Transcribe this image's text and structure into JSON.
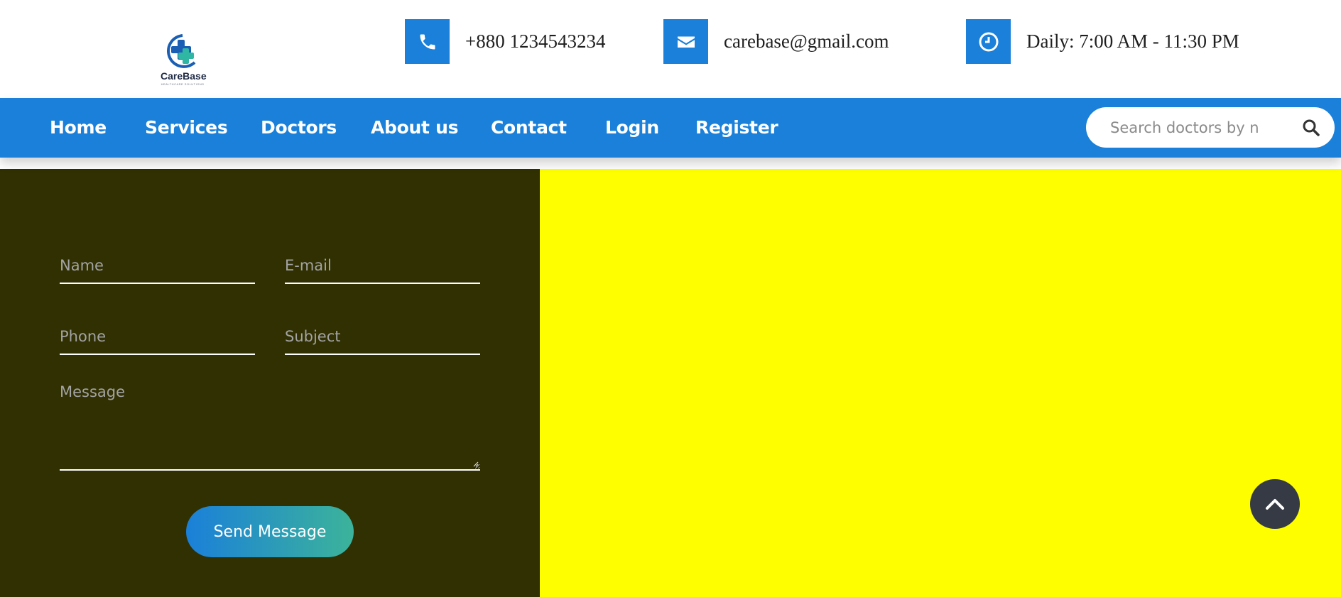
{
  "brand": {
    "logo_alt": "CareBase logo",
    "name": "CareBase",
    "tagline": "HEALTHCARE SOLUTIONS"
  },
  "topbar": {
    "phone": {
      "icon": "phone-icon",
      "text": "+880 1234543234"
    },
    "email": {
      "icon": "envelope-icon",
      "text": "carebase@gmail.com"
    },
    "hours": {
      "icon": "clock-icon",
      "text": "Daily: 7:00 AM - 11:30 PM"
    }
  },
  "nav": {
    "items": [
      {
        "label": "Home"
      },
      {
        "label": "Services"
      },
      {
        "label": "Doctors"
      },
      {
        "label": "About us"
      },
      {
        "label": "Contact"
      },
      {
        "label": "Login"
      },
      {
        "label": "Register"
      }
    ],
    "search": {
      "placeholder": "Search doctors by name",
      "value": "",
      "icon": "search-icon"
    }
  },
  "contact_form": {
    "name_placeholder": "Name",
    "email_placeholder": "E-mail",
    "phone_placeholder": "Phone",
    "subject_placeholder": "Subject",
    "message_placeholder": "Message",
    "submit_label": "Send Message"
  },
  "colors": {
    "primary": "#1a80d9",
    "form_background": "#303003",
    "map_placeholder": "#fefe00",
    "gradient_end": "#3cb39a",
    "scroll_top_button": "#353a44"
  },
  "scroll_top": {
    "icon": "chevron-up-icon"
  }
}
